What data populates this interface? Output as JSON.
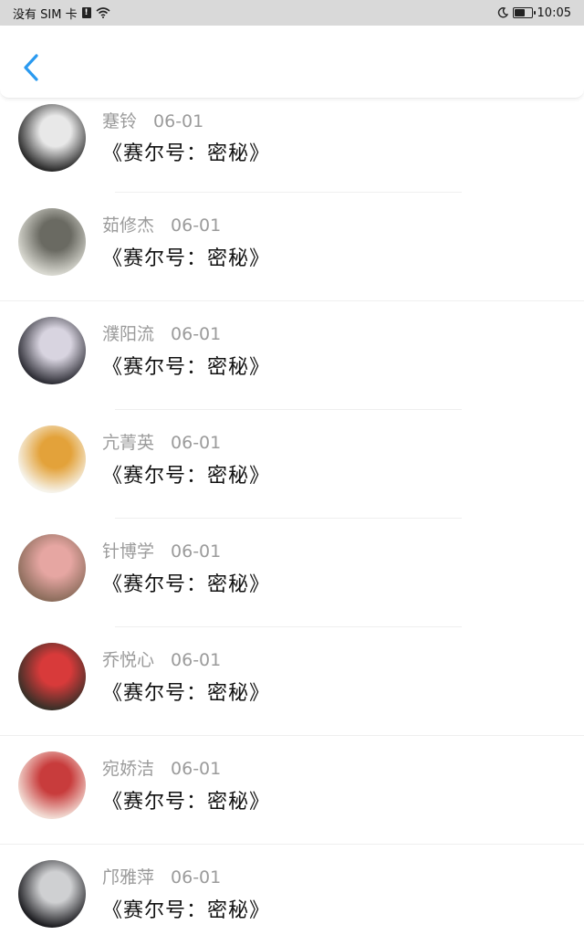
{
  "status_bar": {
    "carrier": "没有 SIM 卡",
    "sim_icon": "sim-alert-icon",
    "time": "10:05",
    "battery_level": 0.65
  },
  "nav": {
    "back_icon": "chevron-left-icon",
    "accent": "#2a9af0"
  },
  "items": [
    {
      "name": "蹇铃",
      "date": "06-01",
      "title": "《赛尔号：密秘》",
      "avatar_colors": [
        "#2b2b2b",
        "#e8e8e8"
      ]
    },
    {
      "name": "茹修杰",
      "date": "06-01",
      "title": "《赛尔号：密秘》",
      "avatar_colors": [
        "#d8d8d0",
        "#6a6a62"
      ]
    },
    {
      "name": "濮阳流",
      "date": "06-01",
      "title": "《赛尔号：密秘》",
      "avatar_colors": [
        "#303038",
        "#d8d4e0"
      ]
    },
    {
      "name": "亢菁英",
      "date": "06-01",
      "title": "《赛尔号：密秘》",
      "avatar_colors": [
        "#f6f3ea",
        "#e3a23a"
      ]
    },
    {
      "name": "针博学",
      "date": "06-01",
      "title": "《赛尔号：密秘》",
      "avatar_colors": [
        "#8c6d5c",
        "#e6a6a2"
      ]
    },
    {
      "name": "乔悦心",
      "date": "06-01",
      "title": "《赛尔号：密秘》",
      "avatar_colors": [
        "#3a3028",
        "#d83a3a"
      ]
    },
    {
      "name": "宛娇洁",
      "date": "06-01",
      "title": "《赛尔号：密秘》",
      "avatar_colors": [
        "#f2dcd4",
        "#c83c3c"
      ]
    },
    {
      "name": "邝雅萍",
      "date": "06-01",
      "title": "《赛尔号：密秘》",
      "avatar_colors": [
        "#1e1e22",
        "#cfd0d2"
      ]
    }
  ]
}
